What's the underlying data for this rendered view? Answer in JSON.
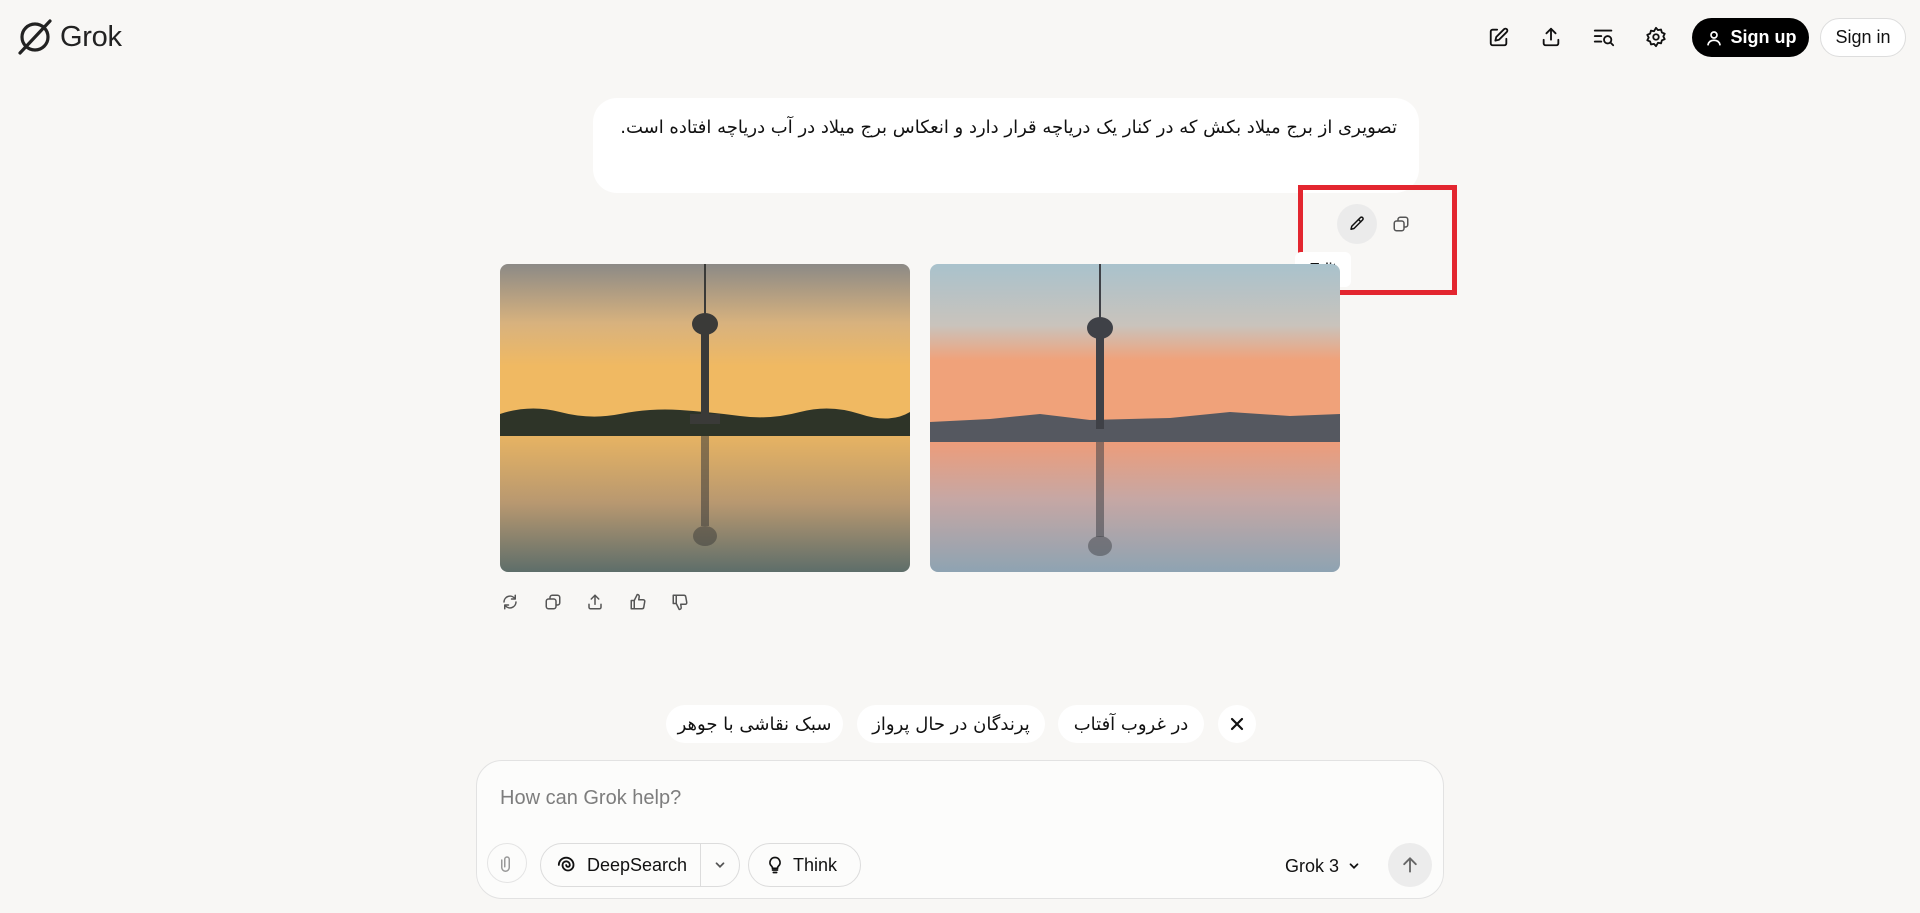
{
  "app": {
    "name": "Grok"
  },
  "header": {
    "icons": [
      "new-chat-icon",
      "share-icon",
      "search-history-icon",
      "settings-icon"
    ],
    "signup_label": "Sign up",
    "signin_label": "Sign in"
  },
  "conversation": {
    "user_message": "تصویری از برج میلاد بکش که در کنار یک دریاچه قرار دارد و انعکاس برج میلاد در آب دریاچه افتاده است.",
    "edit_tooltip": "Edit",
    "images": [
      {
        "description": "milad-tower-sunset-lake-1"
      },
      {
        "description": "milad-tower-sunset-lake-2"
      }
    ],
    "response_actions": [
      "regenerate-icon",
      "copy-icon",
      "share-icon",
      "thumbs-up-icon",
      "thumbs-down-icon"
    ]
  },
  "suggestions": {
    "chips": [
      "در غروب آفتاب",
      "پرندگان در حال پرواز",
      "سبک نقاشی با جوهر"
    ]
  },
  "composer": {
    "placeholder": "How can Grok help?",
    "deepsearch_label": "DeepSearch",
    "think_label": "Think",
    "model_label": "Grok 3"
  },
  "colors": {
    "background": "#f8f7f5",
    "highlight": "#e3262f",
    "primary_button": "#000000"
  }
}
